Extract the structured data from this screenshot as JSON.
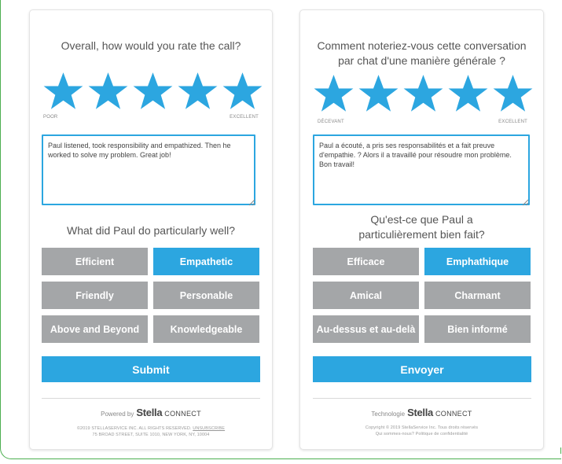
{
  "colors": {
    "accent": "#2ca6e0",
    "tag_gray": "#a4a6a8",
    "frame_green": "#4caf50"
  },
  "rating_value": 5,
  "rating_max": 5,
  "english": {
    "question": "Overall, how would you rate the call?",
    "scale_low": "POOR",
    "scale_high": "EXCELLENT",
    "comment": "Paul listened, took responsibility and empathized. Then he worked to solve my problem. Great job!",
    "followup": "What did Paul do particularly well?",
    "tags": [
      {
        "label": "Efficient",
        "selected": false
      },
      {
        "label": "Empathetic",
        "selected": true
      },
      {
        "label": "Friendly",
        "selected": false
      },
      {
        "label": "Personable",
        "selected": false
      },
      {
        "label": "Above and Beyond",
        "selected": false
      },
      {
        "label": "Knowledgeable",
        "selected": false
      }
    ],
    "submit": "Submit",
    "powered_prefix": "Powered by",
    "brand_stella": "Stella",
    "brand_connect": "CONNECT",
    "legal_line1": "©2019 STELLASERVICE INC. ALL RIGHTS RESERVED.",
    "legal_link": "UNSUBSCRIBE",
    "legal_line2": "75 BROAD STREET, SUITE 1010, NEW YORK, NY, 10004"
  },
  "french": {
    "question": "Comment noteriez-vous cette conversation par chat d'une manière générale ?",
    "scale_low": "DÉCEVANT",
    "scale_high": "EXCELLENT",
    "comment": "Paul a écouté, a pris ses responsabilités et a fait preuve d'empathie. ? Alors il a travaillé pour résoudre mon problème. Bon travail!",
    "followup": "Qu'est-ce que Paul a particulièrement bien fait?",
    "tags": [
      {
        "label": "Efficace",
        "selected": false
      },
      {
        "label": "Emphathique",
        "selected": true
      },
      {
        "label": "Amical",
        "selected": false
      },
      {
        "label": "Charmant",
        "selected": false
      },
      {
        "label": "Au-dessus et au-delà",
        "selected": false
      },
      {
        "label": "Bien informé",
        "selected": false
      }
    ],
    "submit": "Envoyer",
    "powered_prefix": "Technologie",
    "brand_stella": "Stella",
    "brand_connect": "CONNECT",
    "legal_line1": "Copyright © 2019 StellaService Inc. Tous droits réservés",
    "legal_line2": "Qui sommes-nous? Politique de confidentialité"
  }
}
